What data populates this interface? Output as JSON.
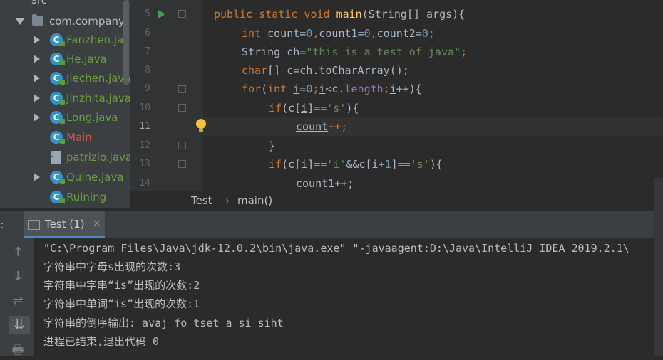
{
  "project_tree": {
    "root": "src",
    "package": "com.company",
    "files": [
      {
        "name": "Fanzhen.java",
        "icon": "java-class-icon",
        "color": "#6a9e3f"
      },
      {
        "name": "He.java",
        "icon": "java-class-icon",
        "color": "#6a9e3f"
      },
      {
        "name": "Jiechen.java",
        "icon": "java-class-icon",
        "color": "#6a9e3f"
      },
      {
        "name": "Jinzhita.java",
        "icon": "java-class-icon",
        "color": "#6a9e3f"
      },
      {
        "name": "Long.java",
        "icon": "java-class-icon",
        "color": "#6a9e3f"
      },
      {
        "name": "Main",
        "icon": "java-class-icon",
        "color": "#d25252"
      },
      {
        "name": "patrizio.java",
        "icon": "java-file-icon",
        "color": "#6a9e3f"
      },
      {
        "name": "Quine.java",
        "icon": "java-class-icon",
        "color": "#6a9e3f"
      },
      {
        "name": "Ruining",
        "icon": "java-class-icon",
        "color": "#6a9e3f"
      }
    ]
  },
  "editor": {
    "line_numbers": [
      "5",
      "6",
      "7",
      "8",
      "9",
      "10",
      "11",
      "12",
      "13",
      "14"
    ],
    "current_line": "11",
    "code": {
      "l5_kw": "public static void ",
      "l5_fn": "main",
      "l5_rest": "(String[] args){",
      "l6_kw": "int ",
      "l6_v1": "count",
      "l6_e1": "=",
      "l6_n1": "0",
      "l6_c1": ",",
      "l6_v2": "count1",
      "l6_e2": "=",
      "l6_n2": "0",
      "l6_c2": ",",
      "l6_v3": "count2",
      "l6_e3": "=",
      "l6_n3": "0",
      "l6_end": ";",
      "l7_a": "String ch=",
      "l7_str": "\"this is a test of java\"",
      "l7_end": ";",
      "l8_kw": "char",
      "l8_rest": "[] c=ch.toCharArray();",
      "l9_kw1": "for",
      "l9_p": "(",
      "l9_kw2": "int ",
      "l9_i1": "i",
      "l9_e": "=",
      "l9_n": "0",
      "l9_s1": ";",
      "l9_i2": "i",
      "l9_lt": "<c.",
      "l9_len": "length",
      "l9_s2": ";",
      "l9_i3": "i",
      "l9_end": "++){",
      "l10_kw": "if",
      "l10_a": "(c[",
      "l10_i": "i",
      "l10_b": "]==",
      "l10_str": "'s'",
      "l10_end": "){",
      "l11_v": "count",
      "l11_end": "++;",
      "l12": "}",
      "l13_kw": "if",
      "l13_a": "(c[",
      "l13_i1": "i",
      "l13_b": "]==",
      "l13_s1": "'i'",
      "l13_c": "&&c[",
      "l13_i2": "i",
      "l13_d": "+",
      "l13_n": "1",
      "l13_e": "]==",
      "l13_s2": "'s'",
      "l13_end": "){",
      "l14": "count1++;"
    }
  },
  "breadcrumb": {
    "class": "Test",
    "sep": "›",
    "method": "main()"
  },
  "run_panel": {
    "label": "n:",
    "tab_label": "Test (1)",
    "tab_close": "×",
    "toolbar": [
      "↑",
      "↓",
      "⇌",
      "⇊",
      "🖶"
    ],
    "output": [
      "\"C:\\Program Files\\Java\\jdk-12.0.2\\bin\\java.exe\" \"-javaagent:D:\\Java\\IntelliJ IDEA 2019.2.1\\",
      "字符串中字母s出现的次数:3",
      "字符串中字串“is”出现的次数:2",
      "字符串中单词“is”出现的次数:1",
      "字符串的倒序输出: avaj fo tset a si siht",
      "进程已结束,退出代码 0"
    ]
  }
}
